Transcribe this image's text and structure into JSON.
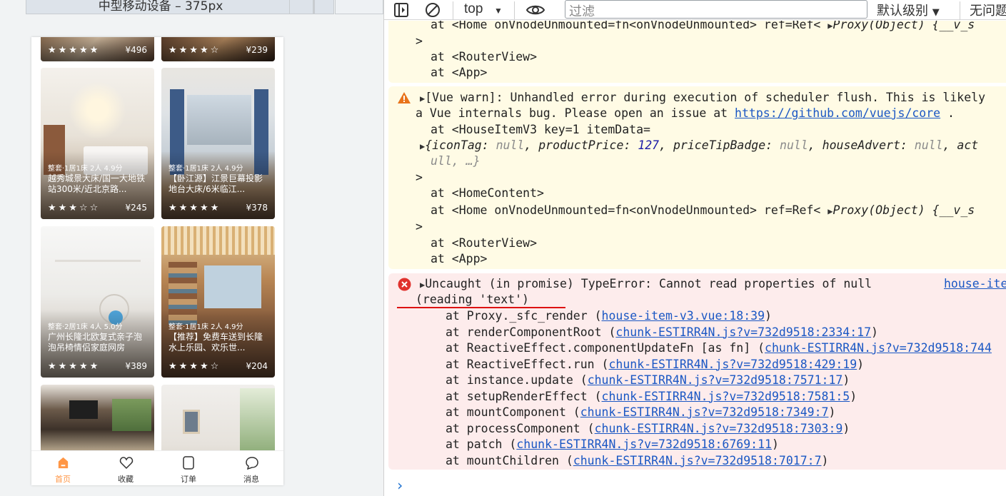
{
  "emulator": {
    "title": "中型移动设备 – 375px",
    "cards": [
      {
        "meta": "",
        "title": "",
        "stars": "★★★★★",
        "price": "¥496"
      },
      {
        "meta": "",
        "title": "",
        "stars": "★★★★☆",
        "price": "¥239"
      },
      {
        "meta": "整套·1居1床 2人 4.9分",
        "title": "越秀城景大床/国一大地铁站300米/近北京路...",
        "stars": "★★★☆☆",
        "price": "¥245"
      },
      {
        "meta": "整套·1居1床 2人 4.9分",
        "title": "【卧江源】江景巨幕投影地台大床/6米临江...",
        "stars": "★★★★★",
        "price": "¥378"
      },
      {
        "meta": "整套·2居1床 4人 5.0分",
        "title": "广州长隆北欧复式亲子泡泡吊椅情侣家庭网房",
        "stars": "★★★★★",
        "price": "¥389"
      },
      {
        "meta": "整套·1居1床 2人 4.9分",
        "title": "【推荐】免费车送到长隆水上乐园、欢乐世...",
        "stars": "★★★★☆",
        "price": "¥204"
      },
      {
        "meta": "",
        "title": "",
        "stars": "",
        "price": ""
      },
      {
        "meta": "",
        "title": "",
        "stars": "",
        "price": ""
      }
    ],
    "tabbar": [
      {
        "label": "首页",
        "icon": "home-icon",
        "active": true
      },
      {
        "label": "收藏",
        "icon": "heart-icon",
        "active": false
      },
      {
        "label": "订单",
        "icon": "order-icon",
        "active": false
      },
      {
        "label": "消息",
        "icon": "message-icon",
        "active": false
      }
    ]
  },
  "console": {
    "toolbar": {
      "context": "top",
      "filter_placeholder": "过滤",
      "level": "默认级别",
      "issues": "无问题"
    },
    "warn_prev": {
      "home_line": "at <Home onVnodeUnmounted=fn<onVnodeUnmounted> ref=Ref< ",
      "proxy": "Proxy(Object) {__v_s",
      "close": ">",
      "router": "at <RouterView>",
      "app": "at <App>"
    },
    "warn": {
      "line1": "[Vue warn]: Unhandled error during execution of scheduler flush. This is likely",
      "line2_prefix": "a Vue internals bug. Please open an issue at ",
      "link": "https://github.com/vuejs/core",
      "line2_suffix": " .",
      "house_item": "at <HouseItemV3 key=1 itemData=",
      "obj_key1": "iconTag",
      "obj_val1": "null",
      "obj_key2": "productPrice",
      "obj_val2": "127",
      "obj_key3": "priceTipBadge",
      "obj_val3": "null",
      "obj_key4": "houseAdvert",
      "obj_val4": "null",
      "obj_key5": "act",
      "obj_tail": "ull, …}",
      "close": ">",
      "home_content": "at <HomeContent>",
      "home_line": "at <Home onVnodeUnmounted=fn<onVnodeUnmounted> ref=Ref< ",
      "proxy": "Proxy(Object) {__v_s",
      "close2": ">",
      "router": "at <RouterView>",
      "app": "at <App>"
    },
    "error": {
      "line1": "Uncaught (in promise) TypeError: Cannot read properties of null",
      "source": "house-ite",
      "line2": "(reading 'text')",
      "stack": [
        {
          "prefix": "at Proxy._sfc_render (",
          "link": "house-item-v3.vue:18:39",
          "suffix": ")"
        },
        {
          "prefix": "at renderComponentRoot (",
          "link": "chunk-ESTIRR4N.js?v=732d9518:2334:17",
          "suffix": ")"
        },
        {
          "prefix": "at ReactiveEffect.componentUpdateFn [as fn] (",
          "link": "chunk-ESTIRR4N.js?v=732d9518:744",
          "suffix": ""
        },
        {
          "prefix": "at ReactiveEffect.run (",
          "link": "chunk-ESTIRR4N.js?v=732d9518:429:19",
          "suffix": ")"
        },
        {
          "prefix": "at instance.update (",
          "link": "chunk-ESTIRR4N.js?v=732d9518:7571:17",
          "suffix": ")"
        },
        {
          "prefix": "at setupRenderEffect (",
          "link": "chunk-ESTIRR4N.js?v=732d9518:7581:5",
          "suffix": ")"
        },
        {
          "prefix": "at mountComponent (",
          "link": "chunk-ESTIRR4N.js?v=732d9518:7349:7",
          "suffix": ")"
        },
        {
          "prefix": "at processComponent (",
          "link": "chunk-ESTIRR4N.js?v=732d9518:7303:9",
          "suffix": ")"
        },
        {
          "prefix": "at patch (",
          "link": "chunk-ESTIRR4N.js?v=732d9518:6769:11",
          "suffix": ")"
        },
        {
          "prefix": "at mountChildren (",
          "link": "chunk-ESTIRR4N.js?v=732d9518:7017:7",
          "suffix": ")"
        }
      ]
    },
    "prompt": "›"
  }
}
